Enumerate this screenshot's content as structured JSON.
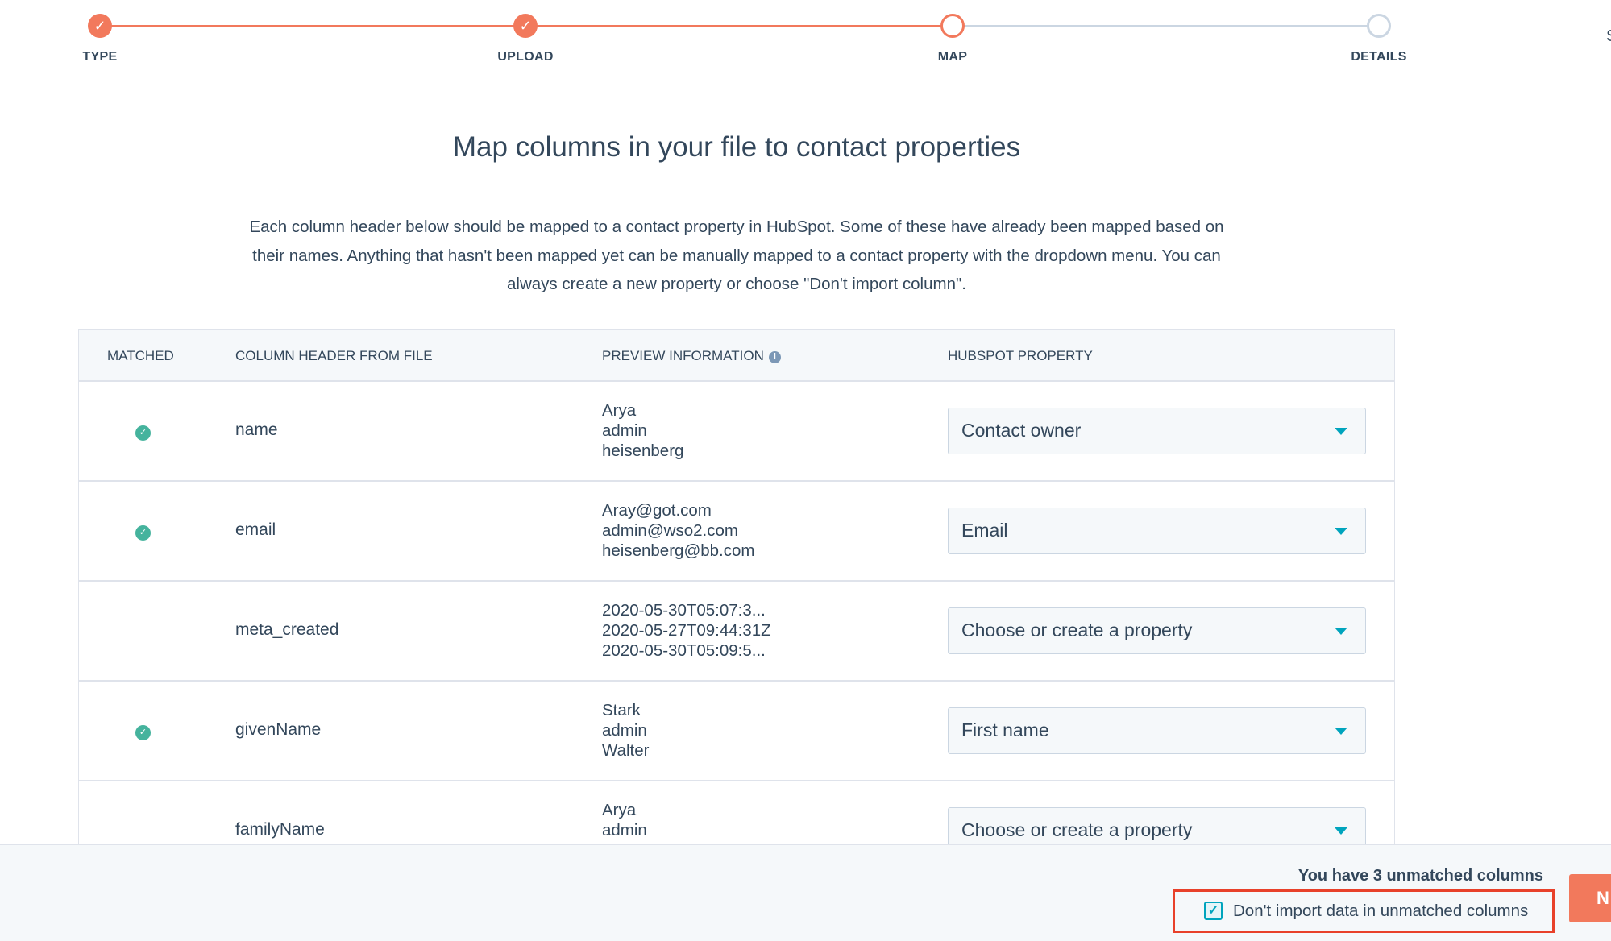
{
  "stepper": {
    "steps": [
      {
        "label": "TYPE",
        "state": "done"
      },
      {
        "label": "UPLOAD",
        "state": "done"
      },
      {
        "label": "MAP",
        "state": "current"
      },
      {
        "label": "DETAILS",
        "state": "todo"
      }
    ],
    "cut_label": "S"
  },
  "title": "Map columns in your file to contact properties",
  "description": "Each column header below should be mapped to a contact property in HubSpot. Some of these have already been mapped based on their names. Anything that hasn't been mapped yet can be manually mapped to a contact property with the dropdown menu. You can always create a new property or choose \"Don't import column\".",
  "table": {
    "headers": {
      "matched": "MATCHED",
      "column": "COLUMN HEADER FROM FILE",
      "preview": "PREVIEW INFORMATION",
      "property": "HUBSPOT PROPERTY"
    },
    "rows": [
      {
        "matched": true,
        "column": "name",
        "preview": [
          "Arya",
          "admin",
          "heisenberg"
        ],
        "property": "Contact owner"
      },
      {
        "matched": true,
        "column": "email",
        "preview": [
          "Aray@got.com",
          "admin@wso2.com",
          "heisenberg@bb.com"
        ],
        "property": "Email"
      },
      {
        "matched": false,
        "column": "meta_created",
        "preview": [
          "2020-05-30T05:07:3...",
          "2020-05-27T09:44:31Z",
          "2020-05-30T05:09:5..."
        ],
        "property": "Choose or create a property"
      },
      {
        "matched": true,
        "column": "givenName",
        "preview": [
          "Stark",
          "admin",
          "Walter"
        ],
        "property": "First name"
      },
      {
        "matched": false,
        "column": "familyName",
        "preview": [
          "Arya",
          "admin"
        ],
        "property": "Choose or create a property"
      }
    ]
  },
  "footer": {
    "unmatched": "You have 3 unmatched columns",
    "checkbox_label": "Don't import data in unmatched columns",
    "checkbox_checked": true,
    "next_label": "N"
  },
  "colors": {
    "accent": "#f2795c",
    "match": "#45b39d",
    "highlight": "#e8412a"
  }
}
